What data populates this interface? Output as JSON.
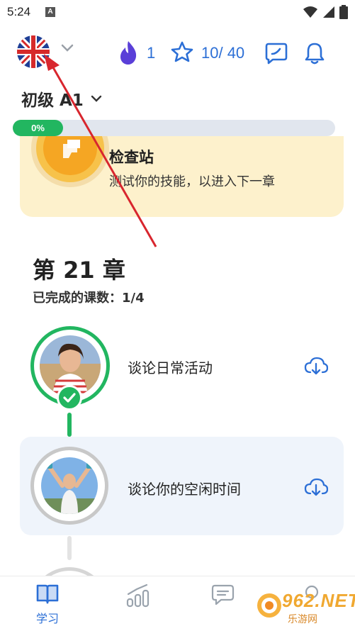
{
  "status_bar": {
    "time": "5:24",
    "notification_icon": "a-app-icon",
    "wifi_icon": "wifi-icon",
    "signal_icon": "signal-icon",
    "battery_icon": "battery-icon"
  },
  "top_bar": {
    "language_flag": "uk-flag-icon",
    "streak_count": "1",
    "xp_text": "10/ 40",
    "accent_color": "#2c6fd6"
  },
  "level": {
    "label": "初级 A1",
    "progress_text": "0%",
    "progress_fraction": 0,
    "progress_color": "#22b660"
  },
  "checkpoint": {
    "title": "检查站",
    "description": "测试你的技能，以进入下一章"
  },
  "chapter": {
    "title": "第 21 章",
    "progress": "已完成的课数：1/4"
  },
  "lessons": [
    {
      "title": "谈论日常活动",
      "status": "completed"
    },
    {
      "title": "谈论你的空闲时间",
      "status": "current"
    },
    {
      "title": "",
      "status": "locked"
    }
  ],
  "bottom_nav": {
    "items": [
      {
        "label": "学习",
        "icon": "book-icon",
        "active": true
      },
      {
        "label": "",
        "icon": "stats-icon",
        "active": false
      },
      {
        "label": "",
        "icon": "chat-bubbles-icon",
        "active": false
      },
      {
        "label": "",
        "icon": "profile-icon",
        "active": false
      }
    ]
  },
  "watermark": {
    "brand": "962.NET",
    "subtitle": "乐游网"
  }
}
